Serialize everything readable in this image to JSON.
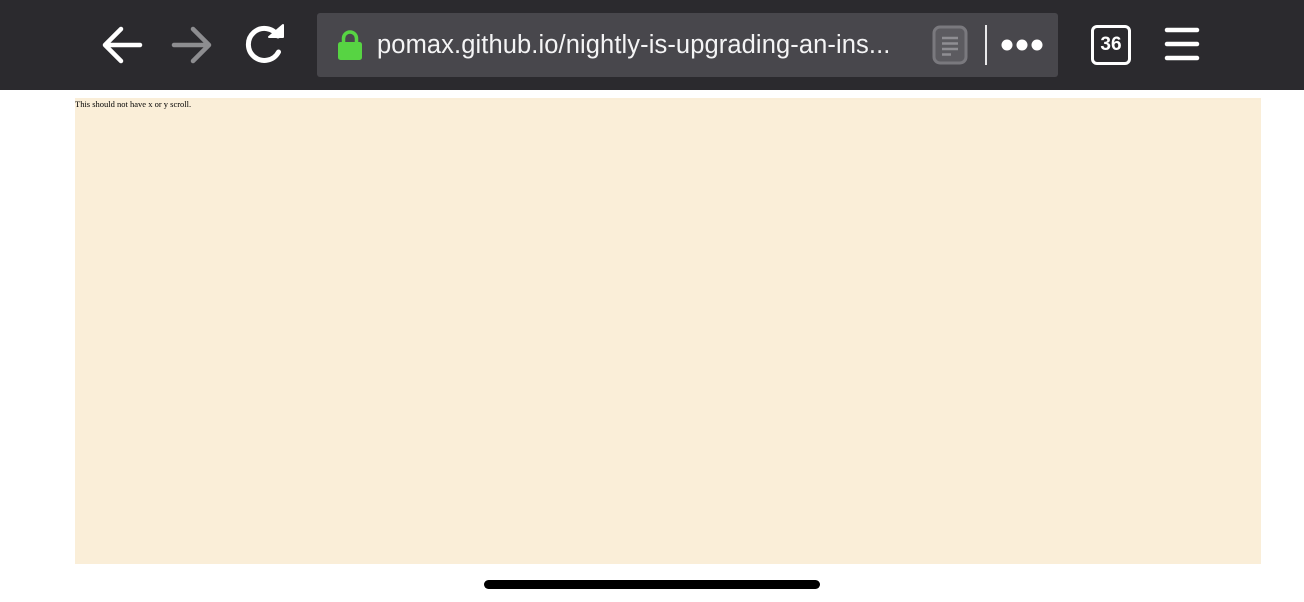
{
  "browser": {
    "url": "pomax.github.io/nightly-is-upgrading-an-ins...",
    "tab_count": "36",
    "icons": {
      "back": "arrow-left-icon",
      "forward": "arrow-right-icon",
      "reload": "reload-icon",
      "lock": "lock-icon",
      "reader": "reader-view-icon",
      "more": "more-dots-icon",
      "menu": "hamburger-menu-icon"
    },
    "colors": {
      "toolbar_bg": "#2b2a2e",
      "urlbar_bg": "#48474c",
      "lock": "#57d443",
      "forward_disabled": "#8d8d90"
    }
  },
  "page": {
    "text": "This should not have x or y scroll.",
    "background": "#faeed8"
  }
}
